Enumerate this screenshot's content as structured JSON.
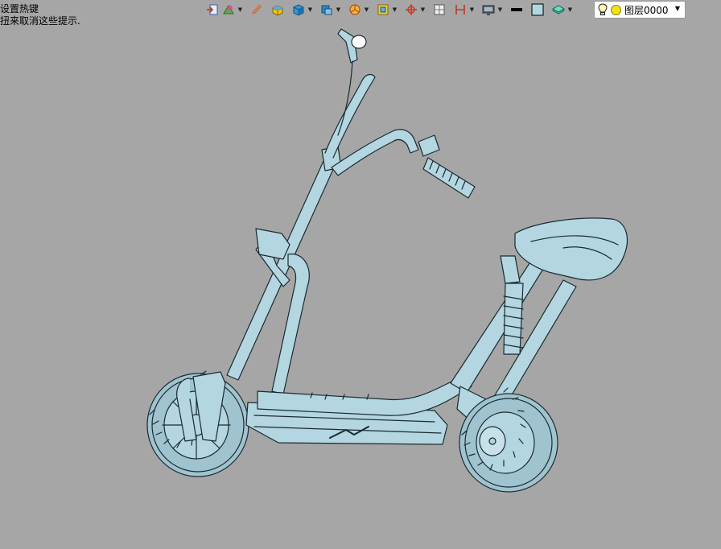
{
  "hint": {
    "line1": "设置热键",
    "line2": "扭来取消这些提示."
  },
  "toolbar": {
    "buttons": [
      {
        "name": "close-doc-icon"
      },
      {
        "name": "render-style-icon",
        "dropdown": true
      },
      {
        "name": "measure-icon"
      },
      {
        "name": "box-yellow-icon"
      },
      {
        "name": "box-blue-icon",
        "dropdown": true
      },
      {
        "name": "view-cube-icon",
        "dropdown": true
      },
      {
        "name": "pie-icon",
        "dropdown": true
      },
      {
        "name": "frame-icon",
        "dropdown": true
      },
      {
        "name": "axis-icon",
        "dropdown": true
      },
      {
        "name": "grid-icon"
      },
      {
        "name": "section-icon",
        "dropdown": true
      },
      {
        "name": "monitor-icon",
        "dropdown": true
      },
      {
        "name": "line-color-icon"
      },
      {
        "name": "fill-color-icon"
      },
      {
        "name": "layer-stack-icon",
        "dropdown": true
      }
    ]
  },
  "layer_select": {
    "value": "图层0000"
  },
  "model": {
    "fill_color": "#b3d6e0",
    "edge_color": "#1a2a30",
    "background": "#a6a6a6"
  }
}
